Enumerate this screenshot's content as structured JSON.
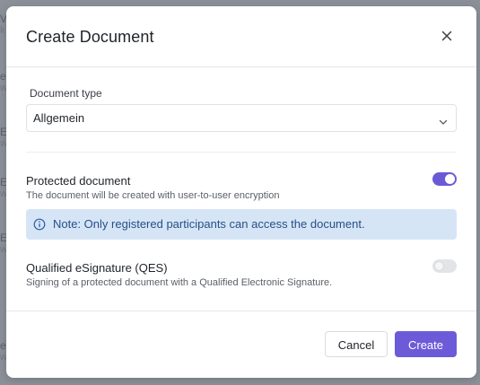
{
  "background": {
    "rows": [
      {
        "l1": "V",
        "l2": "k"
      },
      {
        "l1": "e",
        "l2": "w"
      },
      {
        "l1": "E",
        "l2": "w"
      },
      {
        "l1": "E",
        "l2": "w"
      },
      {
        "l1": "E",
        "l2": "w"
      },
      {
        "l1": "e",
        "l2": "w"
      }
    ]
  },
  "dialog": {
    "title": "Create Document",
    "close_icon": "close-icon",
    "document_type": {
      "label": "Document type",
      "value": "Allgemein",
      "chevron_icon": "chevron-down-icon"
    },
    "protected": {
      "title": "Protected document",
      "description": "The document will be created with user-to-user encryption",
      "enabled": true,
      "note": "Note: Only registered participants can access the document.",
      "note_icon": "info-icon"
    },
    "qes": {
      "title": "Qualified eSignature (QES)",
      "description": "Signing of a protected document with a Qualified Electronic Signature.",
      "enabled": false
    },
    "buttons": {
      "cancel": "Cancel",
      "create": "Create"
    }
  },
  "colors": {
    "accent": "#6c5bd8",
    "note_bg": "#d6e5f6",
    "note_text": "#274f86",
    "overlay": "#8c9098"
  }
}
